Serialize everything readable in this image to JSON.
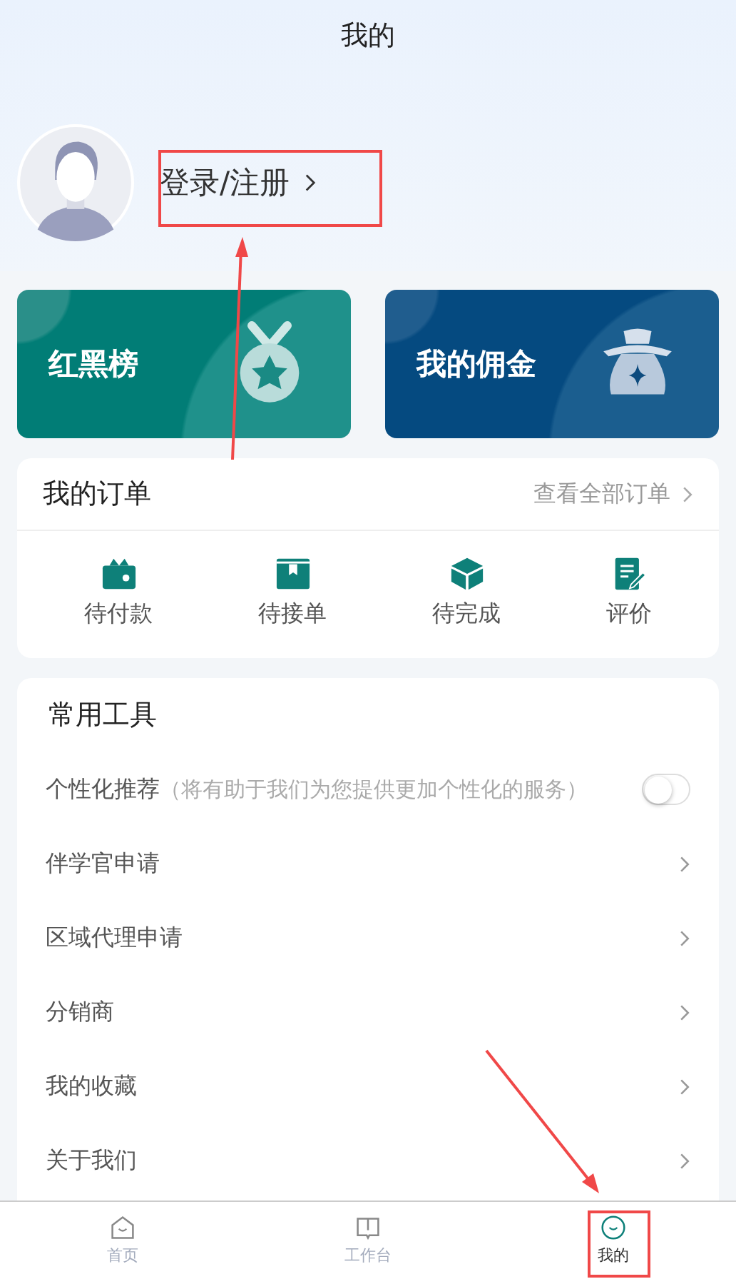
{
  "header": {
    "title": "我的"
  },
  "profile": {
    "login": "登录/注册"
  },
  "cards": [
    {
      "kind": "ranking",
      "label": "红黑榜"
    },
    {
      "kind": "commission",
      "label": "我的佣金"
    }
  ],
  "orders": {
    "title": "我的订单",
    "view_all": "查看全部订单",
    "items": [
      {
        "kind": "wallet",
        "label": "待付款"
      },
      {
        "kind": "inbox",
        "label": "待接单"
      },
      {
        "kind": "box",
        "label": "待完成"
      },
      {
        "kind": "review",
        "label": "评价"
      }
    ]
  },
  "tools": {
    "title": "常用工具",
    "items": [
      {
        "kind": "toggle",
        "label": "个性化推荐",
        "note": "（将有助于我们为您提供更加个性化的服务）",
        "on": false
      },
      {
        "kind": "link",
        "label": "伴学官申请"
      },
      {
        "kind": "link",
        "label": "区域代理申请"
      },
      {
        "kind": "link",
        "label": "分销商"
      },
      {
        "kind": "link",
        "label": "我的收藏"
      },
      {
        "kind": "link",
        "label": "关于我们"
      }
    ]
  },
  "tab_bar": [
    {
      "kind": "home",
      "label": "首页",
      "selected": false
    },
    {
      "kind": "book",
      "label": "工作台",
      "selected": false
    },
    {
      "kind": "smile",
      "label": "我的",
      "selected": true
    }
  ]
}
